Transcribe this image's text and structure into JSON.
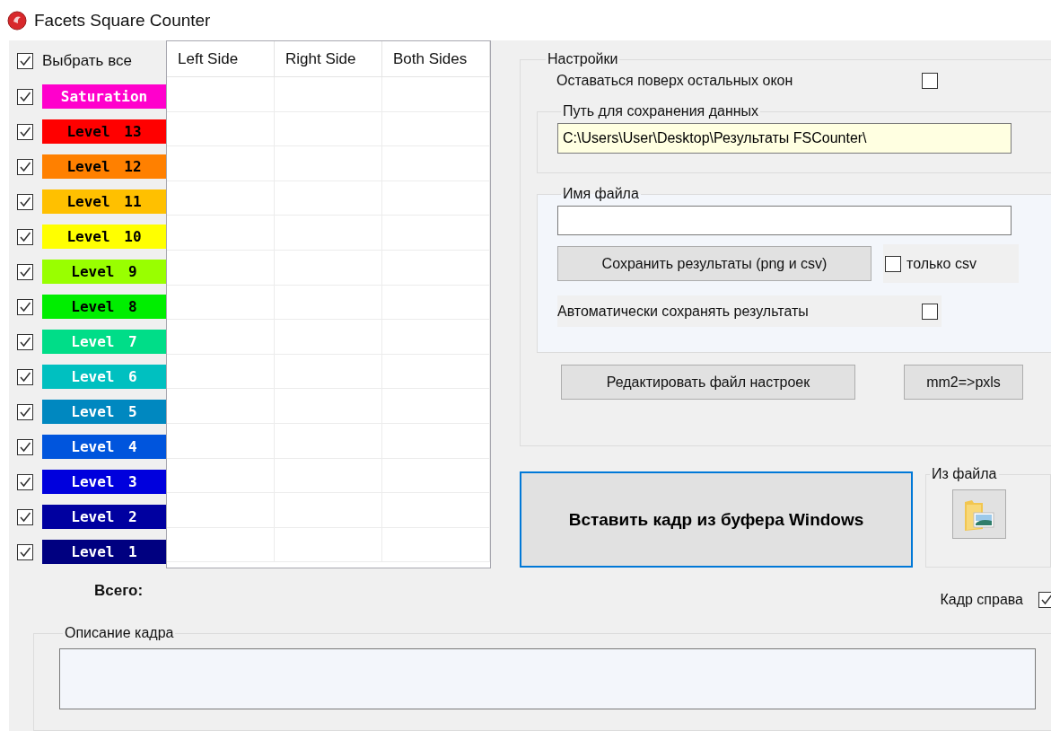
{
  "window": {
    "title": "Facets Square Counter"
  },
  "select_all": {
    "label": "Выбрать все",
    "checked": true
  },
  "levels": [
    {
      "label": "Saturation",
      "color": "#ff00cc",
      "dark_text": false,
      "checked": true
    },
    {
      "label": "Level 13",
      "color": "#ff0000",
      "dark_text": true,
      "checked": true
    },
    {
      "label": "Level 12",
      "color": "#ff8000",
      "dark_text": true,
      "checked": true
    },
    {
      "label": "Level 11",
      "color": "#ffc000",
      "dark_text": true,
      "checked": true
    },
    {
      "label": "Level 10",
      "color": "#ffff00",
      "dark_text": true,
      "checked": true
    },
    {
      "label": "Level 9",
      "color": "#99ff00",
      "dark_text": true,
      "checked": true
    },
    {
      "label": "Level 8",
      "color": "#00ee00",
      "dark_text": true,
      "checked": true
    },
    {
      "label": "Level 7",
      "color": "#00dd88",
      "dark_text": false,
      "checked": true
    },
    {
      "label": "Level 6",
      "color": "#00c0c0",
      "dark_text": false,
      "checked": true
    },
    {
      "label": "Level 5",
      "color": "#0088c0",
      "dark_text": false,
      "checked": true
    },
    {
      "label": "Level 4",
      "color": "#0055dd",
      "dark_text": false,
      "checked": true
    },
    {
      "label": "Level 3",
      "color": "#0000dd",
      "dark_text": false,
      "checked": true
    },
    {
      "label": "Level 2",
      "color": "#0000a0",
      "dark_text": false,
      "checked": true
    },
    {
      "label": "Level 1",
      "color": "#000080",
      "dark_text": false,
      "checked": true
    }
  ],
  "table": {
    "columns": [
      "Left Side",
      "Right Side",
      "Both Sides"
    ]
  },
  "total_label": "Всего:",
  "settings": {
    "title": "Настройки",
    "stay_on_top": {
      "label": "Оставаться поверх остальных окон",
      "checked": false
    },
    "path_group": {
      "title": "Путь для сохранения данных",
      "value": "C:\\Users\\User\\Desktop\\Результаты FSCounter\\"
    },
    "file_group": {
      "title": "Имя файла",
      "save_button": "Сохранить результаты (png и csv)",
      "csv_only": {
        "label": "только csv",
        "checked": false
      },
      "auto_save": {
        "label": "Автоматически сохранять результаты",
        "checked": false
      }
    },
    "edit_button": "Редактировать файл настроек",
    "convert_button": "mm2=>pxls"
  },
  "paste_button": "Вставить кадр из буфера Windows",
  "from_file": {
    "title": "Из файла"
  },
  "frame_right": {
    "label": "Кадр справа",
    "checked": true
  },
  "description": {
    "title": "Описание кадра"
  }
}
